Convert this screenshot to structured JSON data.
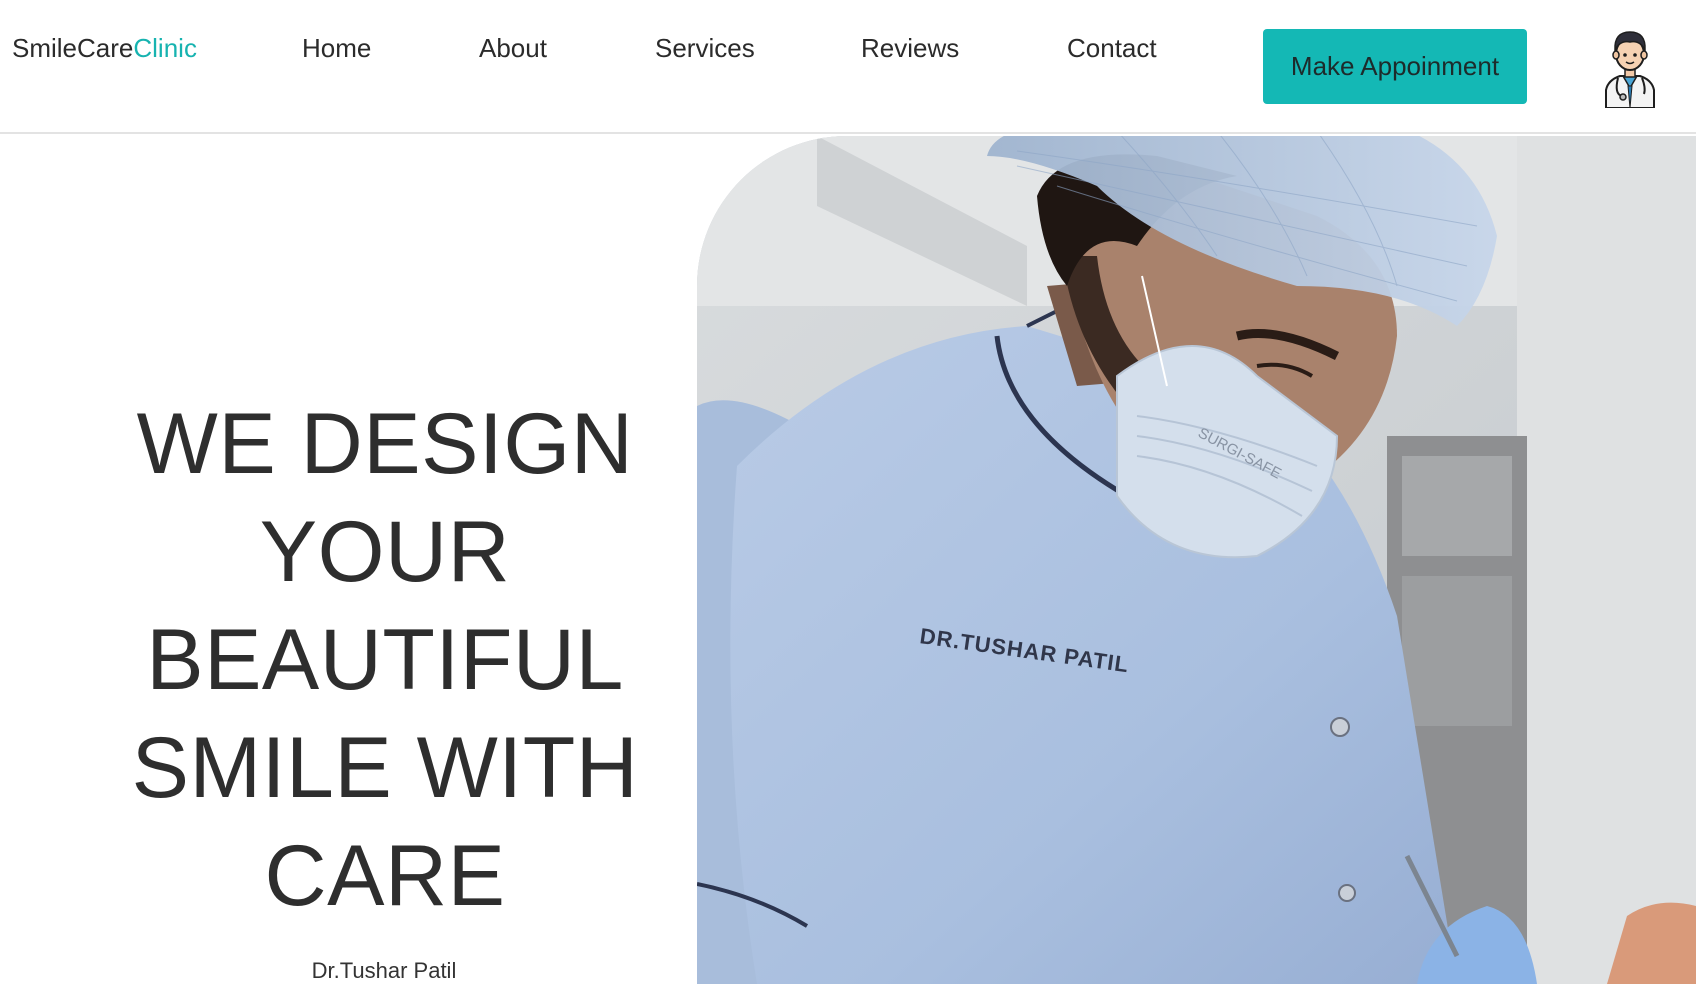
{
  "brand": {
    "name_primary": "SmileCare",
    "name_accent": "Clinic",
    "accent_color": "#17b3b0"
  },
  "nav": {
    "items": [
      {
        "label": "Home"
      },
      {
        "label": "About"
      },
      {
        "label": "Services"
      },
      {
        "label": "Reviews"
      },
      {
        "label": "Contact"
      }
    ],
    "cta_label": "Make Appoinment",
    "cta_color": "#14b8b5",
    "avatar_icon": "doctor-avatar-icon"
  },
  "hero": {
    "headline_lines": [
      "WE DESIGN",
      "YOUR",
      "BEAUTIFUL",
      "SMILE WITH",
      "CARE"
    ],
    "doctor_name": "Dr.Tushar Patil",
    "photo": {
      "description_icon": "dentist-at-work-photo",
      "scrub_name": "DR.TUSHAR PATIL",
      "mask_text": "SURGI-SAFE"
    }
  }
}
